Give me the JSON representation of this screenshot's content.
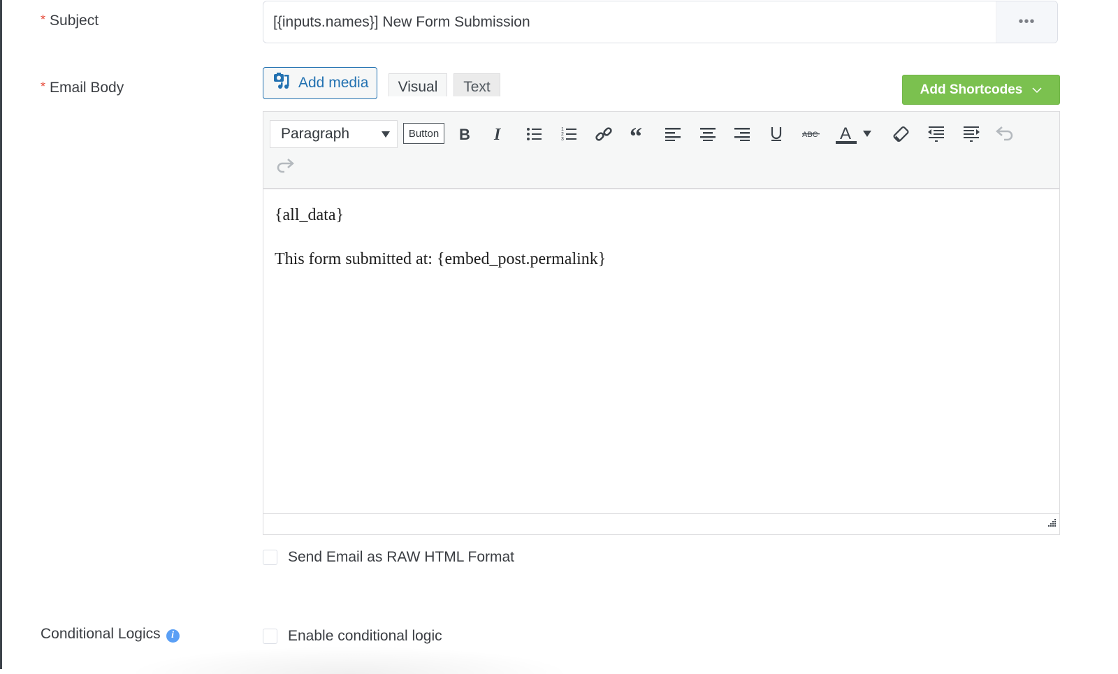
{
  "subject": {
    "label": "Subject",
    "required_mark": "*",
    "value": "[{inputs.names}] New Form Submission",
    "more_label": "•••"
  },
  "email_body": {
    "label": "Email Body",
    "required_mark": "*",
    "add_media_label": "Add media",
    "tabs": [
      {
        "label": "Visual",
        "active": true
      },
      {
        "label": "Text",
        "active": false
      }
    ],
    "shortcodes_label": "Add Shortcodes",
    "toolbar": {
      "format_select": "Paragraph",
      "button_label": "Button",
      "icons": [
        "bold-icon",
        "italic-icon",
        "bullet-list-icon",
        "numbered-list-icon",
        "link-icon",
        "blockquote-icon",
        "align-left-icon",
        "align-center-icon",
        "align-right-icon",
        "underline-icon",
        "strikethrough-icon",
        "text-color-icon",
        "text-color-dropdown-icon",
        "clear-formatting-icon",
        "outdent-icon",
        "indent-icon",
        "undo-icon",
        "redo-icon"
      ]
    },
    "content": [
      "{all_data}",
      "This form submitted at: {embed_post.permalink}"
    ]
  },
  "raw_html": {
    "label": "Send Email as RAW HTML Format",
    "checked": false
  },
  "conditional": {
    "label": "Conditional Logics",
    "checkbox_label": "Enable conditional logic",
    "checked": false
  },
  "colors": {
    "accent_blue": "#2271b1",
    "shortcode_green": "#7bc14f",
    "required_red": "#e74c3c",
    "info_blue": "#5a9ff5"
  }
}
